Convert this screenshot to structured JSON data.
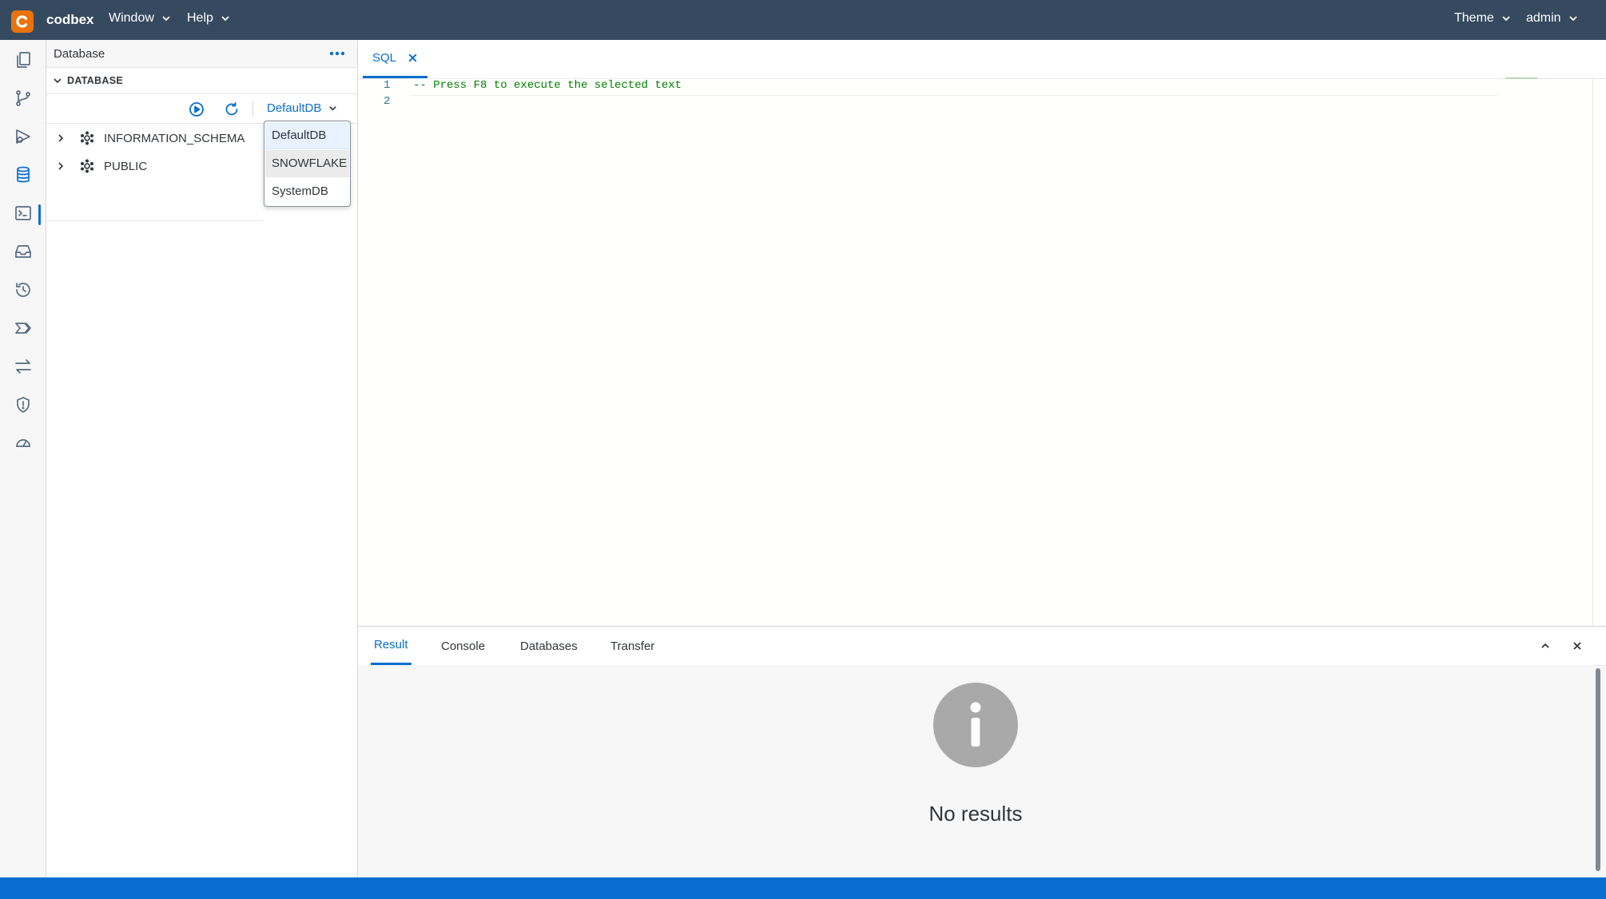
{
  "header": {
    "brand": "codbex",
    "menus": {
      "window": "Window",
      "help": "Help",
      "theme": "Theme",
      "user": "admin"
    }
  },
  "activity_bar": {
    "icons": [
      "projects-icon",
      "git-icon",
      "deploy-icon",
      "database-icon",
      "terminal-icon",
      "inbox-icon",
      "history-icon",
      "pipeline-icon",
      "transfer-icon",
      "security-icon",
      "monitor-icon"
    ],
    "active": "database-icon"
  },
  "left_panel": {
    "title": "Database",
    "section": "DATABASE",
    "selected_db": "DefaultDB",
    "tree": [
      {
        "label": "INFORMATION_SCHEMA"
      },
      {
        "label": "PUBLIC"
      }
    ],
    "dropdown": {
      "options": [
        "DefaultDB",
        "SNOWFLAKE",
        "SystemDB"
      ],
      "selected": "DefaultDB",
      "hovered": "SNOWFLAKE"
    }
  },
  "editor": {
    "tab_label": "SQL",
    "line_numbers": [
      "1",
      "2"
    ],
    "lines": [
      "-- Press F8 to execute the selected text",
      ""
    ]
  },
  "bottom_panel": {
    "tabs": [
      "Result",
      "Console",
      "Databases",
      "Transfer"
    ],
    "active_tab": "Result",
    "empty_message": "No results"
  },
  "colors": {
    "header_bg": "#354a5f",
    "accent": "#0a6ed1",
    "logo": "#e9730c",
    "comment": "#008000"
  }
}
